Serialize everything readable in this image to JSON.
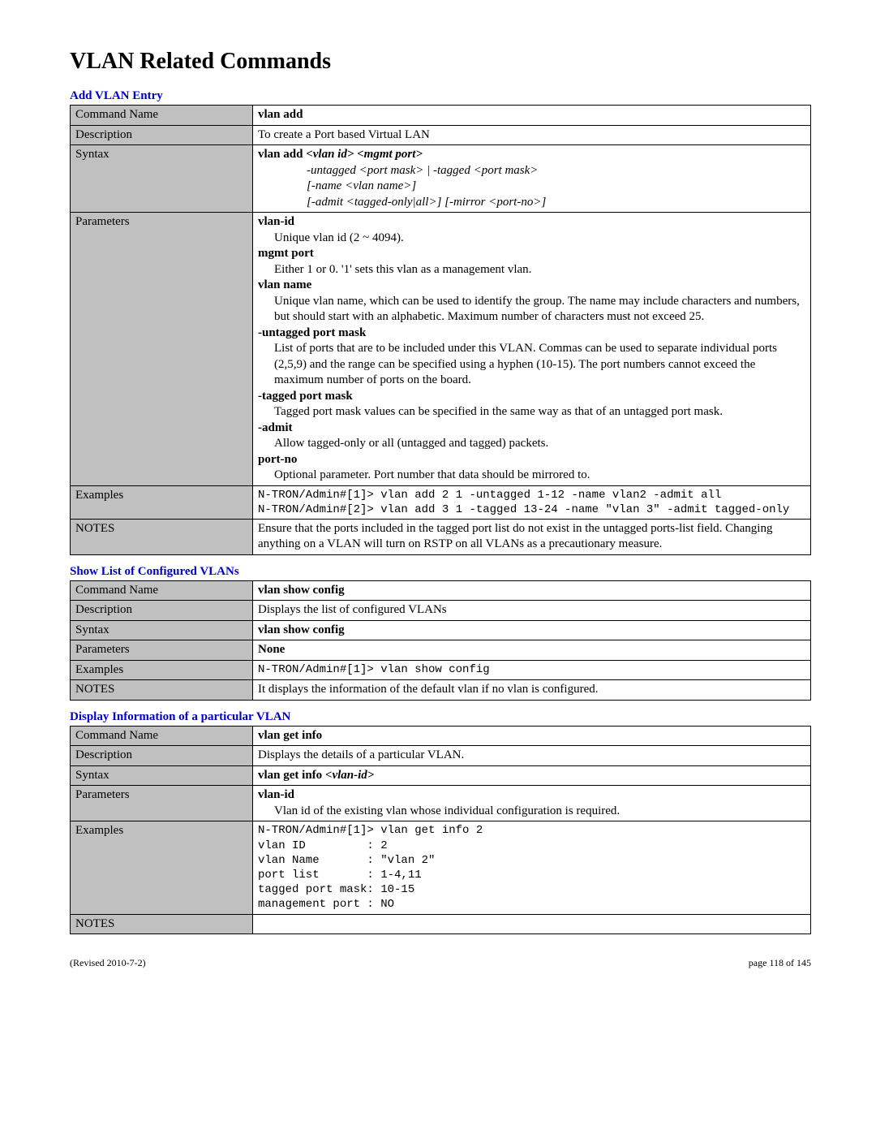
{
  "title": "VLAN Related Commands",
  "sections": [
    {
      "title": "Add VLAN Entry",
      "command_name": "vlan add",
      "description": "To create a Port based Virtual LAN",
      "syntax_main_prefix": "vlan add ",
      "syntax_main_args": "<vlan id> <mgmt port>",
      "syntax_lines": [
        "-untagged <port mask> |  -tagged <port mask>",
        "[-name <vlan name>]",
        "[-admit <tagged-only|all>] [-mirror <port-no>]"
      ],
      "params": [
        {
          "name": "vlan-id",
          "desc": "Unique vlan id (2 ~ 4094)."
        },
        {
          "name": "mgmt port",
          "desc": "Either 1 or 0. '1' sets this vlan as a management vlan."
        },
        {
          "name": "vlan name",
          "desc": "Unique vlan name, which can be used to identify the group. The name may include characters and numbers, but should start with an alphabetic. Maximum number of characters must not exceed 25."
        },
        {
          "name": "-untagged port mask",
          "desc": "List of ports that are to be included under this VLAN.  Commas can be used to separate individual ports (2,5,9) and the range can be specified using a hyphen (10-15).  The port numbers cannot exceed the maximum number of ports on the board."
        },
        {
          "name": "-tagged port mask",
          "desc": "Tagged port mask values can be specified in the same way as that of an untagged port mask."
        },
        {
          "name": "-admit",
          "desc": "Allow tagged-only or all (untagged and tagged) packets."
        },
        {
          "name": "port-no",
          "desc": "Optional parameter.  Port number that data should be mirrored to."
        }
      ],
      "examples": "N-TRON/Admin#[1]> vlan add 2 1 -untagged 1-12 -name vlan2 -admit all\nN-TRON/Admin#[2]> vlan add 3 1 -tagged 13-24 -name \"vlan 3\" -admit tagged-only",
      "notes": "Ensure that the ports included in the tagged port list do not exist in the untagged ports-list field.  Changing anything on a VLAN will turn on RSTP on all VLANs as a precautionary measure."
    },
    {
      "title": "Show List of Configured VLANs",
      "command_name": "vlan show config",
      "description": "Displays the list of configured VLANs",
      "syntax_plain": "vlan show config",
      "params_plain": "None",
      "examples": "N-TRON/Admin#[1]> vlan show config",
      "notes": "It displays the information of the default vlan if no vlan is configured."
    },
    {
      "title": "Display Information of a particular VLAN",
      "command_name": "vlan get info",
      "description": "Displays the details of a particular VLAN.",
      "syntax_main_prefix": "vlan get info ",
      "syntax_main_args": "<vlan-id>",
      "params": [
        {
          "name": "vlan-id",
          "desc": "Vlan id of the existing vlan whose individual configuration is required."
        }
      ],
      "examples": "N-TRON/Admin#[1]> vlan get info 2\nvlan ID         : 2\nvlan Name       : \"vlan 2\"\nport list       : 1-4,11\ntagged port mask: 10-15\nmanagement port : NO",
      "notes": ""
    }
  ],
  "labels": {
    "command_name": "Command Name",
    "description": "Description",
    "syntax": "Syntax",
    "parameters": "Parameters",
    "examples": "Examples",
    "notes": "NOTES"
  },
  "footer": {
    "left": "(Revised 2010-7-2)",
    "right": "page 118 of 145"
  }
}
